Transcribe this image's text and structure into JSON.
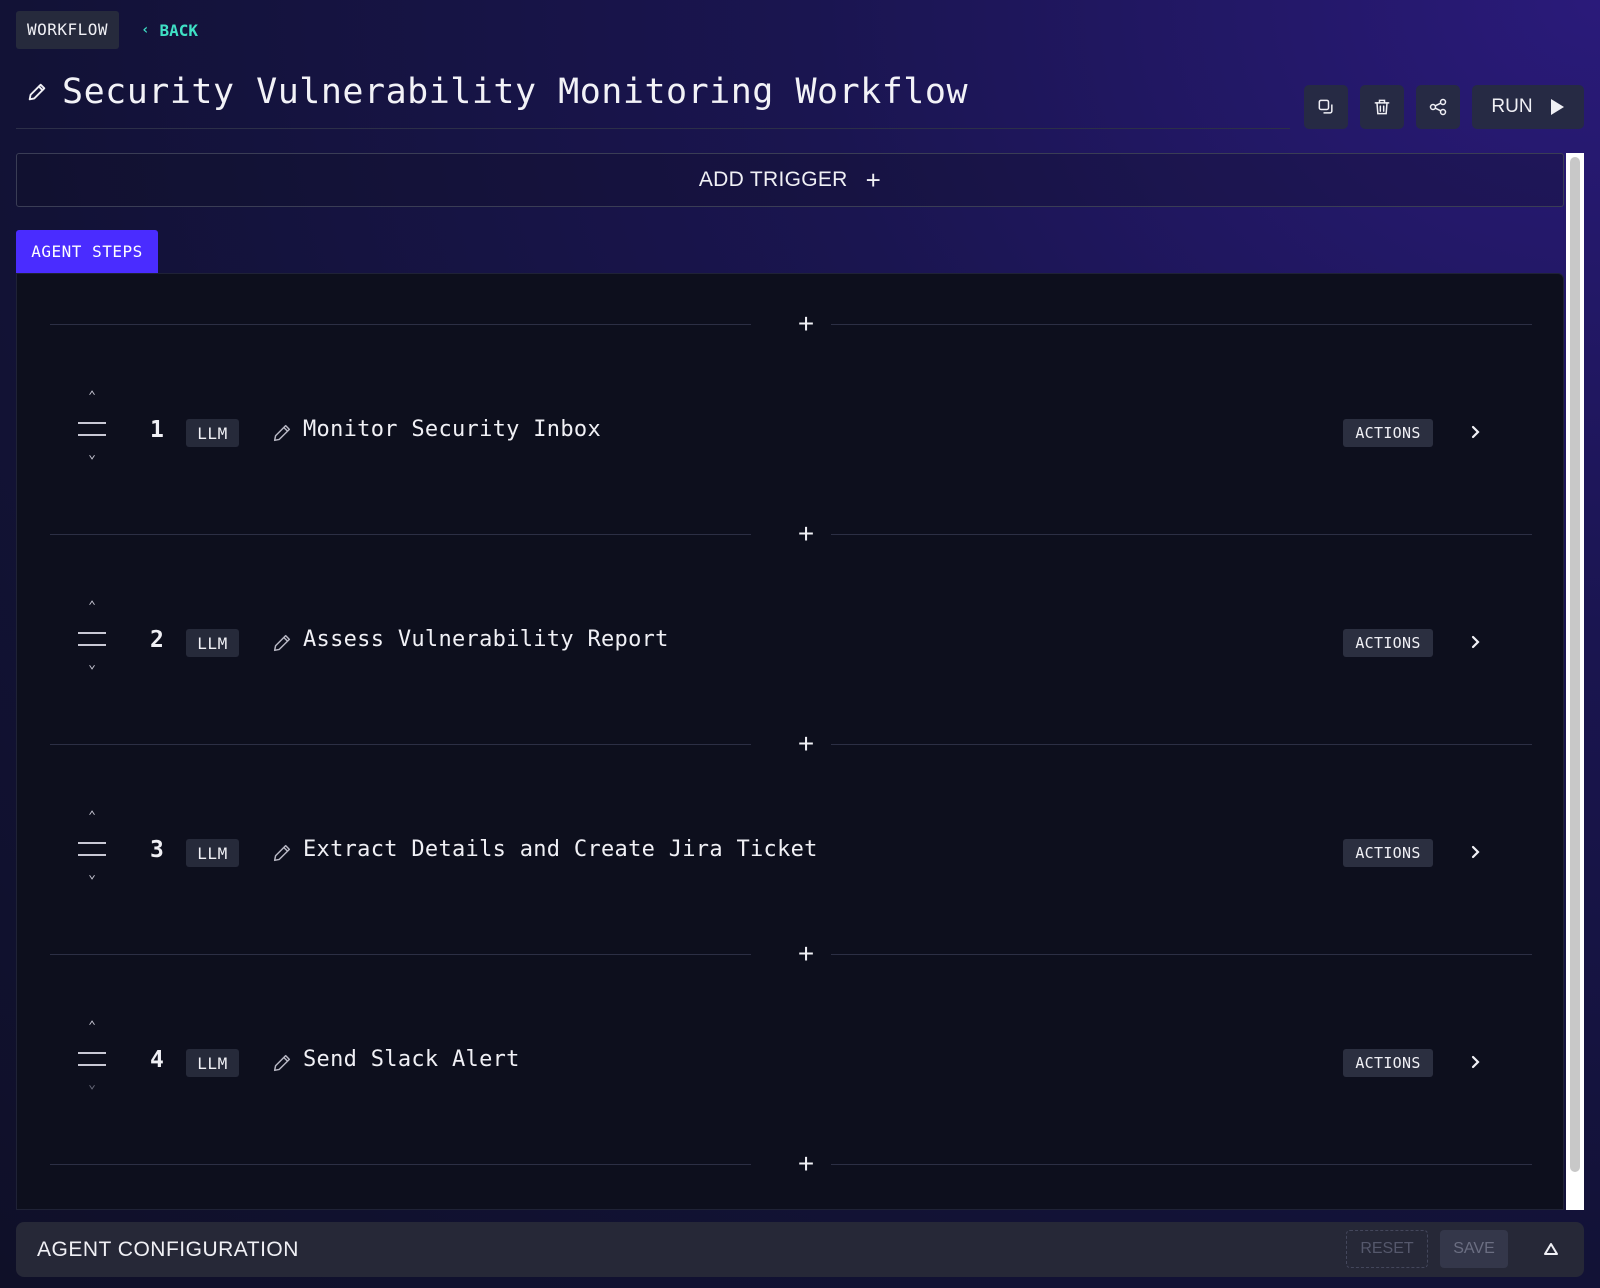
{
  "breadcrumb": {
    "label": "WORKFLOW",
    "back_label": "BACK",
    "back_icon": "chevron-left-icon"
  },
  "page": {
    "title": "Security Vulnerability Monitoring Workflow"
  },
  "toolbar": {
    "copy_icon": "copy-icon",
    "delete_icon": "trash-icon",
    "share_icon": "share-icon",
    "run_label": "RUN",
    "run_icon": "play-icon"
  },
  "trigger": {
    "label": "ADD TRIGGER",
    "plus": "+"
  },
  "tabs": [
    {
      "label": "AGENT STEPS",
      "active": true
    }
  ],
  "insert_symbol": "+",
  "steps": [
    {
      "number": "1",
      "type": "LLM",
      "name": "Monitor Security Inbox",
      "actions_label": "ACTIONS"
    },
    {
      "number": "2",
      "type": "LLM",
      "name": "Assess Vulnerability Report",
      "actions_label": "ACTIONS"
    },
    {
      "number": "3",
      "type": "LLM",
      "name": "Extract Details and Create Jira Ticket",
      "actions_label": "ACTIONS"
    },
    {
      "number": "4",
      "type": "LLM",
      "name": "Send Slack Alert",
      "actions_label": "ACTIONS"
    }
  ],
  "config": {
    "title": "AGENT CONFIGURATION",
    "reset_label": "RESET",
    "save_label": "SAVE"
  },
  "colors": {
    "accent": "#4a2cff",
    "back_link": "#3fe0c5",
    "panel_bg": "#0d0f1d",
    "page_bg": "#121236"
  }
}
